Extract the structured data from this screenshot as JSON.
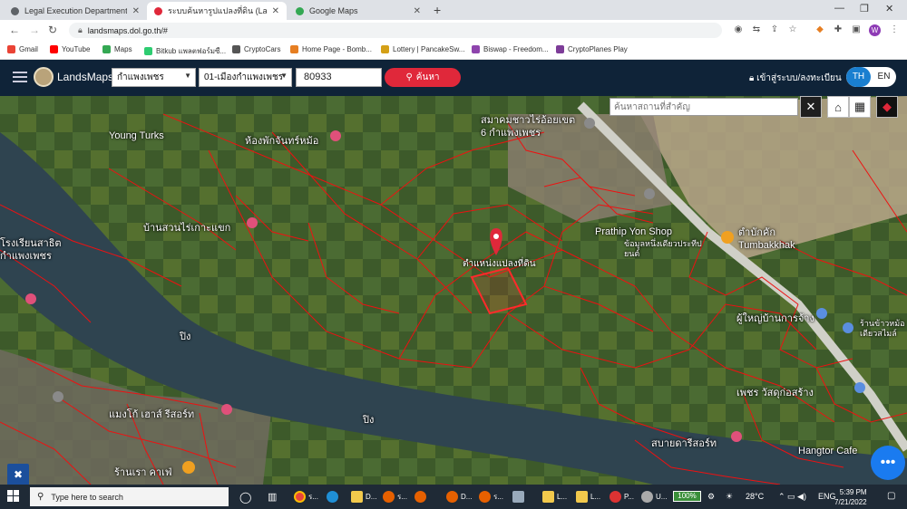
{
  "browser": {
    "tabs": [
      {
        "title": "Legal Execution Department:",
        "color": "#5f6368",
        "active": false
      },
      {
        "title": "ระบบค้นหารูปแปลงที่ดิน (LandsMaps)",
        "color": "#e0283a",
        "active": true
      },
      {
        "title": "Google Maps",
        "color": "#34a853",
        "active": false
      }
    ],
    "new_tab": "+",
    "url": "landsmaps.dol.go.th/#",
    "profile_initial": "W"
  },
  "bookmarks": [
    {
      "label": "Gmail",
      "color": "#ea4335"
    },
    {
      "label": "YouTube",
      "color": "#ff0000"
    },
    {
      "label": "Maps",
      "color": "#34a853"
    },
    {
      "label": "Bitkub แพลตฟอร์มซื...",
      "color": "#2ecc71"
    },
    {
      "label": "CryptoCars",
      "color": "#555555"
    },
    {
      "label": "Home Page - Bomb...",
      "color": "#e67e22"
    },
    {
      "label": "Lottery | PancakeSw...",
      "color": "#d4a017"
    },
    {
      "label": "Biswap - Freedom...",
      "color": "#8e44ad"
    },
    {
      "label": "CryptoPlanes Play",
      "color": "#7d3c98"
    }
  ],
  "app": {
    "brand": "LandsMaps",
    "province": "กำแพงเพชร",
    "district": "01-เมืองกำแพงเพชร",
    "parcel_no": "80933",
    "search_label": "ค้นหา",
    "login_label": "เข้าสู่ระบบ/ลงทะเบียน",
    "lang_th": "TH",
    "lang_en": "EN",
    "accent": "#e0283a"
  },
  "map": {
    "place_search_placeholder": "ค้นหาสถานที่สำคัญ",
    "labels": [
      "Young Turks",
      "ห้องพักจันทร์หม้อ",
      "สมาคมชาวไร่อ้อยเขต 6 กำแพงเพชร",
      "บ้านสวนไร่เกาะแขก",
      "ตำแหน่งแปลงที่ดิน",
      "Prathip Yon Shop",
      "ข้อมูลหนึ่งเดียวประทีปยนต์",
      "ตำบักคัก Tumbakkhak",
      "ผู้ใหญ่บ้านการจ้าง",
      "ร้านข้าวหม้อเดียวสไมล์",
      "โรงเรียนสาธิตกำแพงเพชร",
      "ปิง",
      "ปิง",
      "แมงโก้ เฮาส์ รีสอร์ท",
      "เพชร วัสดุก่อสร้าง",
      "สบายดารีสอร์ท",
      "Hangtor Cafe",
      "ร้านเรา คาเฟ่"
    ]
  },
  "taskbar": {
    "search_placeholder": "Type here to search",
    "battery": "100%",
    "weather": "28°C",
    "lang": "ENG",
    "time": "5:39 PM",
    "date": "7/21/2022",
    "apps": [
      "D...",
      "ร...",
      "D...",
      "ร...",
      "L...",
      "L...",
      "P...",
      "U..."
    ]
  }
}
